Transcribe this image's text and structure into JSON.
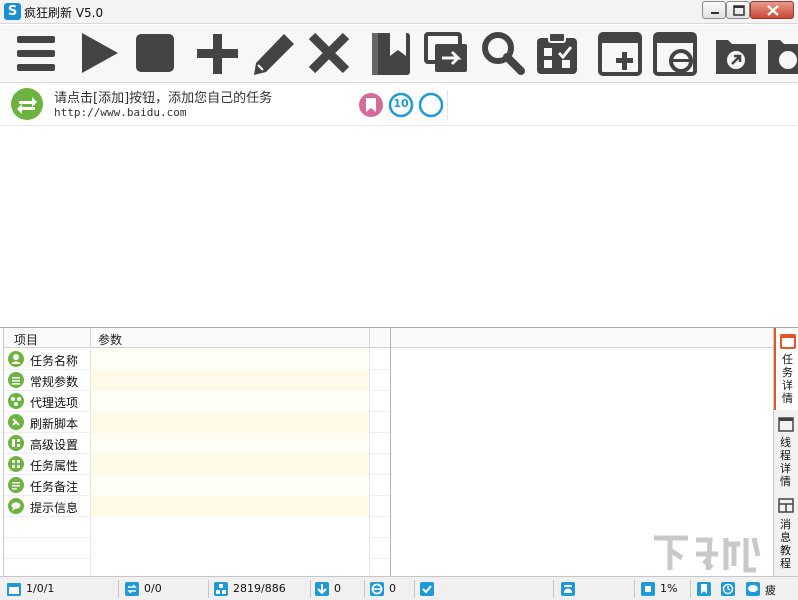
{
  "window": {
    "title": "疯狂刷新 V5.0",
    "logo_letter": "S"
  },
  "toolbar": {
    "buttons": [
      {
        "name": "menu-icon"
      },
      {
        "name": "play-icon"
      },
      {
        "name": "stop-icon"
      },
      {
        "name": "add-icon"
      },
      {
        "name": "edit-icon"
      },
      {
        "name": "delete-icon"
      },
      {
        "name": "bookmark-icon"
      },
      {
        "name": "copy-icon"
      },
      {
        "name": "search-icon"
      },
      {
        "name": "clipboard-icon"
      },
      {
        "name": "new-window-icon"
      },
      {
        "name": "ie-window-icon"
      },
      {
        "name": "folder-export-icon"
      },
      {
        "name": "folder-icon"
      }
    ]
  },
  "task": {
    "name": "请点击[添加]按钮，添加您自己的任务",
    "url": "http://www.baidu.com",
    "badge_count": "10",
    "colors": {
      "bookmark": "#d46b9a",
      "badge": "#1f9ad6",
      "green": "#6db33f"
    }
  },
  "properties": {
    "headers": {
      "item": "项目",
      "param": "参数"
    },
    "rows": [
      {
        "label": "任务名称",
        "icon": "user-icon"
      },
      {
        "label": "常规参数",
        "icon": "settings-list-icon"
      },
      {
        "label": "代理选项",
        "icon": "network-icon"
      },
      {
        "label": "刷新脚本",
        "icon": "script-icon"
      },
      {
        "label": "高级设置",
        "icon": "advanced-icon"
      },
      {
        "label": "任务属性",
        "icon": "grid-icon"
      },
      {
        "label": "任务备注",
        "icon": "notes-icon"
      },
      {
        "label": "提示信息",
        "icon": "message-icon"
      }
    ]
  },
  "side_tabs": [
    {
      "label": "任务详情",
      "icon": "task-detail-icon"
    },
    {
      "label": "线程详情",
      "icon": "thread-detail-icon"
    },
    {
      "label": "消息教程",
      "icon": "message-tutorial-icon"
    }
  ],
  "status": {
    "page": "1/0/1",
    "refresh": "0/0",
    "counter": "2819/886",
    "download": "0",
    "ie": "0",
    "cpu": "1%",
    "last": "疲"
  },
  "watermark": "下载吧"
}
